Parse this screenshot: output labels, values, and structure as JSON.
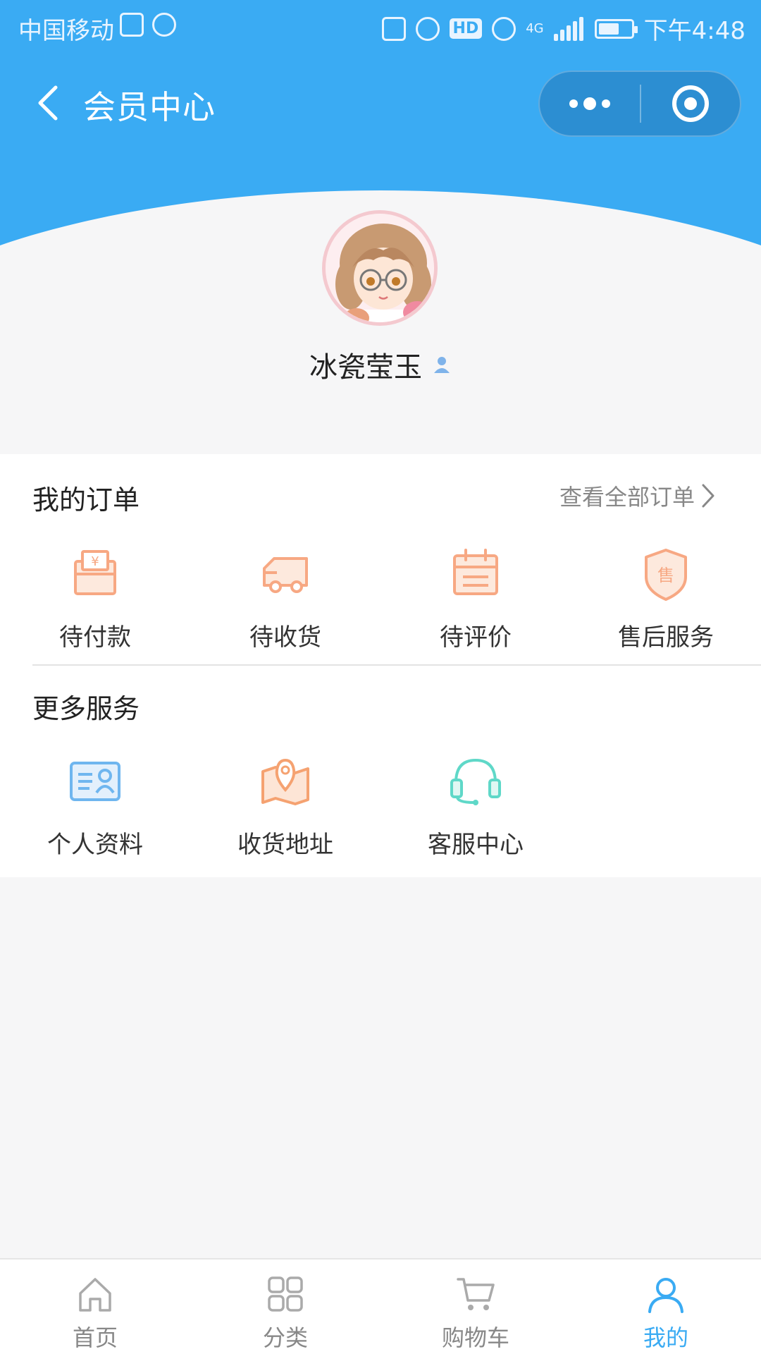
{
  "status_bar": {
    "carrier": "中国移动",
    "network": "4G",
    "hd": "HD",
    "time": "下午4:48"
  },
  "navbar": {
    "title": "会员中心",
    "back_icon": "chevron-left-icon",
    "more_icon": "more-dots-icon",
    "close_icon": "target-close-icon"
  },
  "profile": {
    "username": "冰瓷莹玉",
    "badge_icon": "user-badge-icon"
  },
  "orders": {
    "title": "我的订单",
    "view_all": "查看全部订单",
    "items": [
      {
        "label": "待付款",
        "icon": "wallet-icon"
      },
      {
        "label": "待收货",
        "icon": "truck-icon"
      },
      {
        "label": "待评价",
        "icon": "calendar-icon"
      },
      {
        "label": "售后服务",
        "icon": "shield-icon"
      }
    ]
  },
  "services": {
    "title": "更多服务",
    "items": [
      {
        "label": "个人资料",
        "icon": "id-card-icon"
      },
      {
        "label": "收货地址",
        "icon": "map-pin-icon"
      },
      {
        "label": "客服中心",
        "icon": "headset-icon"
      }
    ]
  },
  "shield_char": "售",
  "tabbar": {
    "items": [
      {
        "label": "首页",
        "icon": "home-icon"
      },
      {
        "label": "分类",
        "icon": "category-icon"
      },
      {
        "label": "购物车",
        "icon": "cart-icon"
      },
      {
        "label": "我的",
        "icon": "user-icon"
      }
    ],
    "active_index": 3
  },
  "colors": {
    "primary": "#3aabf3",
    "order_icon": "#f7a883",
    "service_blue": "#6fb6ef",
    "service_orange": "#f5a271",
    "service_teal": "#5fd8c8"
  }
}
